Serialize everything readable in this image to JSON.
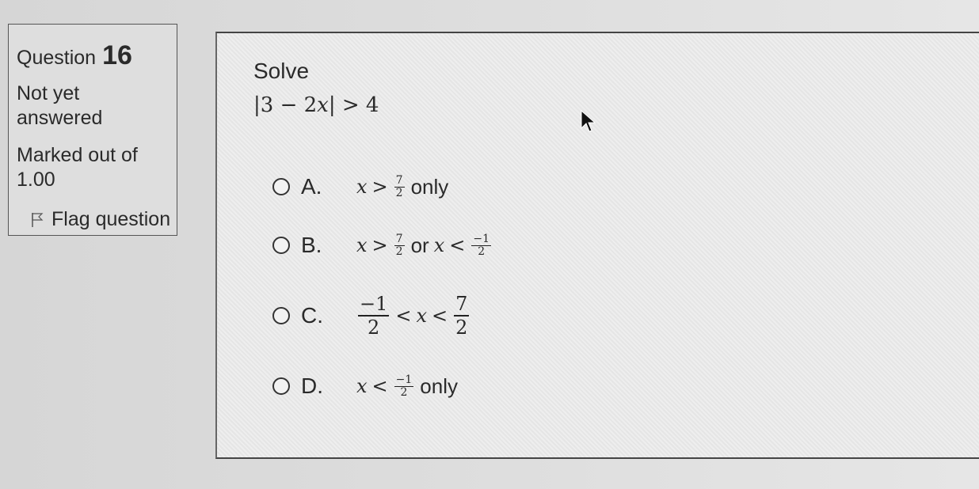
{
  "question": {
    "label": "Question",
    "number": "16",
    "status": "Not yet answered",
    "marks": "Marked out of 1.00",
    "flag_label": "Flag question"
  },
  "prompt": {
    "title": "Solve",
    "equation": {
      "lhs": "|3 − 2",
      "var": "x",
      "rhs": "| > 4"
    }
  },
  "options": [
    {
      "letter": "A.",
      "var": "x",
      "op": ">",
      "num": "7",
      "den": "2",
      "tail": "only"
    },
    {
      "letter": "B.",
      "var1": "x",
      "op1": ">",
      "num1": "7",
      "den1": "2",
      "joiner": "or",
      "var2": "x",
      "op2": "<",
      "num2": "−1",
      "den2": "2"
    },
    {
      "letter": "C.",
      "num1": "−1",
      "den1": "2",
      "op1": "<",
      "var": "x",
      "op2": "<",
      "num2": "7",
      "den2": "2"
    },
    {
      "letter": "D.",
      "var": "x",
      "op": "<",
      "num": "−1",
      "den": "2",
      "tail": "only"
    }
  ]
}
